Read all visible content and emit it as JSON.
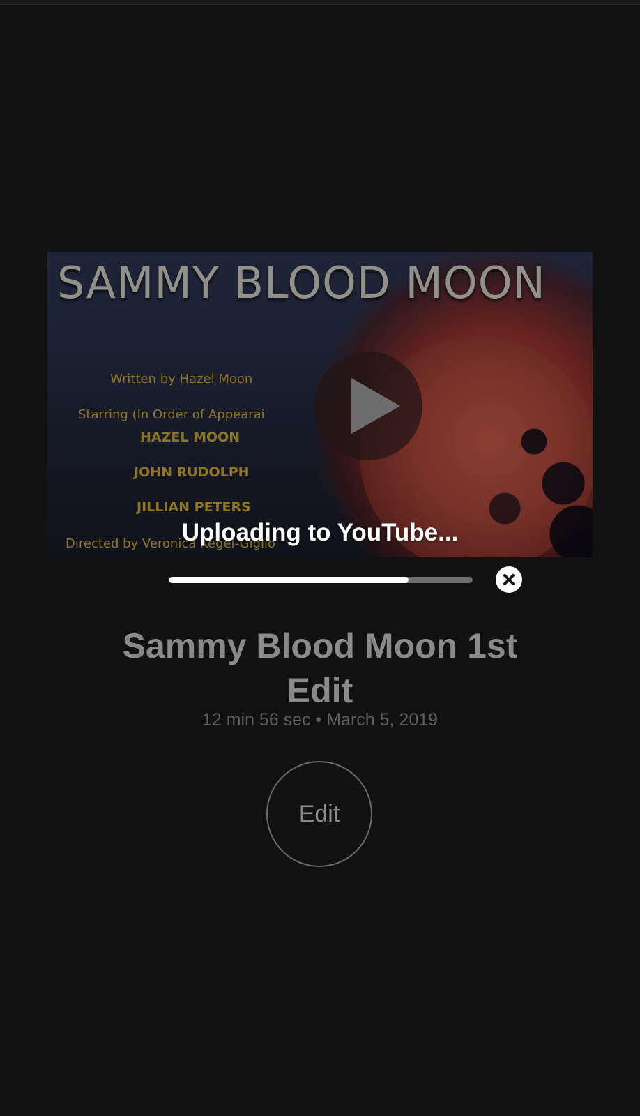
{
  "video": {
    "thumbnail": {
      "title": "SAMMY BLOOD MOON",
      "written_by": "Written by Hazel Moon",
      "starring": "Starring (In Order of Appearai",
      "cast": [
        "HAZEL MOON",
        "JOHN RUDOLPH",
        "JILLIAN PETERS"
      ],
      "directed_by": "Directed by Veronica Kegel-Giglio"
    },
    "play_icon": "play-icon",
    "upload_status": "Uploading to YouTube..."
  },
  "upload": {
    "progress_percent": 79,
    "cancel_icon": "close-icon"
  },
  "details": {
    "title": "Sammy Blood Moon 1st Edit",
    "meta": "12 min 56 sec • March 5, 2019"
  },
  "actions": {
    "edit_label": "Edit"
  },
  "colors": {
    "background": "#111111",
    "progress_fill": "#ffffff",
    "progress_track": "#6e6e6e",
    "title_text": "#8a8a8a"
  }
}
